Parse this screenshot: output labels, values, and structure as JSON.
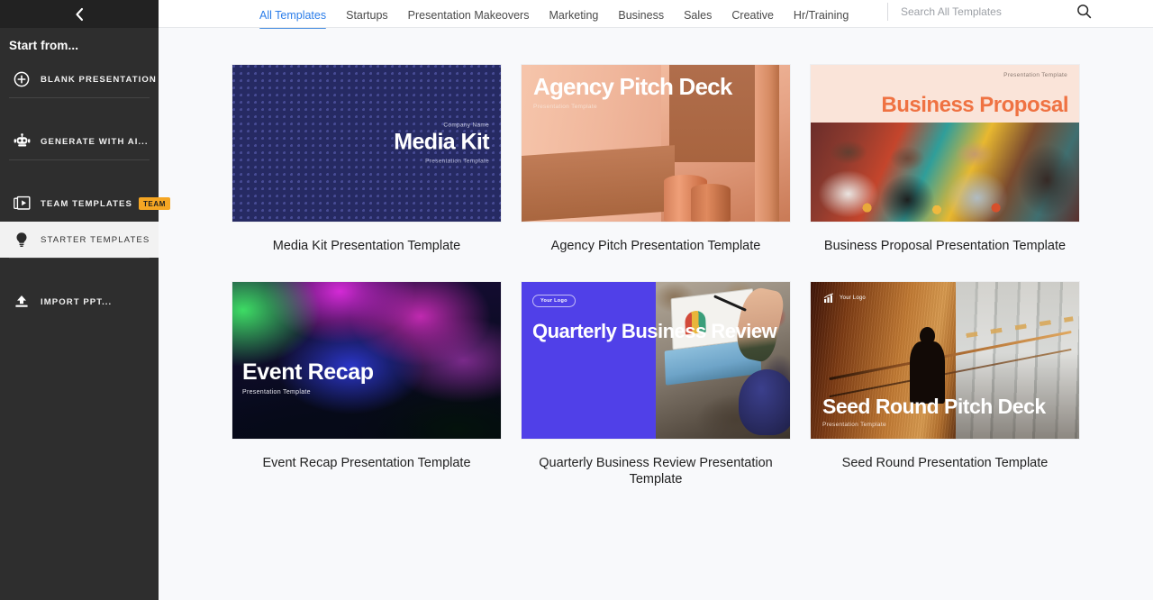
{
  "sidebar": {
    "back_icon": "chevron-left-icon",
    "heading": "Start from...",
    "items": [
      {
        "label": "Blank Presentation",
        "icon": "plus-circle-icon",
        "badge": null,
        "active": false
      },
      {
        "label": "Generate with AI...",
        "icon": "robot-ai-icon",
        "badge": null,
        "active": false
      },
      {
        "label": "Team Templates",
        "icon": "slides-stack-icon",
        "badge": "TEAM",
        "active": false
      },
      {
        "label": "Starter Templates",
        "icon": "lightbulb-icon",
        "badge": null,
        "active": true
      },
      {
        "label": "Import PPT...",
        "icon": "upload-icon",
        "badge": null,
        "active": false
      }
    ],
    "badge_color": "#f5a623"
  },
  "topbar": {
    "tabs": [
      {
        "label": "All Templates",
        "active": true
      },
      {
        "label": "Startups",
        "active": false
      },
      {
        "label": "Presentation Makeovers",
        "active": false
      },
      {
        "label": "Marketing",
        "active": false
      },
      {
        "label": "Business",
        "active": false
      },
      {
        "label": "Sales",
        "active": false
      },
      {
        "label": "Creative",
        "active": false
      },
      {
        "label": "Hr/Training",
        "active": false
      }
    ],
    "active_color": "#2b7de9",
    "search": {
      "placeholder": "Search All Templates",
      "value": "",
      "icon": "search-icon"
    }
  },
  "templates": [
    {
      "caption": "Media Kit Presentation Template",
      "slide": {
        "eyebrow": "Company Name",
        "title": "Media Kit",
        "subtitle": "Presentation Template"
      }
    },
    {
      "caption": "Agency Pitch Presentation Template",
      "slide": {
        "title": "Agency Pitch Deck",
        "subtitle": "Presentation Template"
      }
    },
    {
      "caption": "Business Proposal Presentation Template",
      "slide": {
        "eyebrow": "Presentation Template",
        "title": "Business Proposal"
      }
    },
    {
      "caption": "Event Recap Presentation Template",
      "slide": {
        "title": "Event Recap",
        "subtitle": "Presentation Template"
      }
    },
    {
      "caption": "Quarterly Business Review Presentation Template",
      "slide": {
        "logo": "Your Logo",
        "title": "Quarterly Business Review"
      }
    },
    {
      "caption": "Seed Round Presentation Template",
      "slide": {
        "logo": "Your Logo",
        "title": "Seed Round Pitch Deck",
        "subtitle": "Presentation Template"
      }
    }
  ]
}
